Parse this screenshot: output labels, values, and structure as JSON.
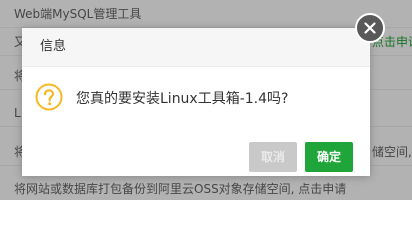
{
  "background": {
    "rows": [
      {
        "text": "Web端MySQL管理工具",
        "right": ""
      },
      {
        "text": "又",
        "right": "点击申请"
      },
      {
        "text": "将",
        "right": ""
      },
      {
        "text": "L",
        "right": ""
      },
      {
        "text": "将",
        "right": "储空间,点"
      },
      {
        "text": "将网站或数据库打包备份到阿里云OSS对象存储空间, 点击申请",
        "right": ""
      }
    ]
  },
  "dialog": {
    "title": "信息",
    "message": "您真的要安装Linux工具箱-1.4吗?",
    "cancel_label": "取消",
    "confirm_label": "确定"
  },
  "colors": {
    "accent": "#20a53a",
    "question": "#f7b824",
    "overlay": "rgba(0,0,0,0.30)"
  },
  "icons": {
    "question": "question-circle-icon",
    "close": "close-icon"
  }
}
